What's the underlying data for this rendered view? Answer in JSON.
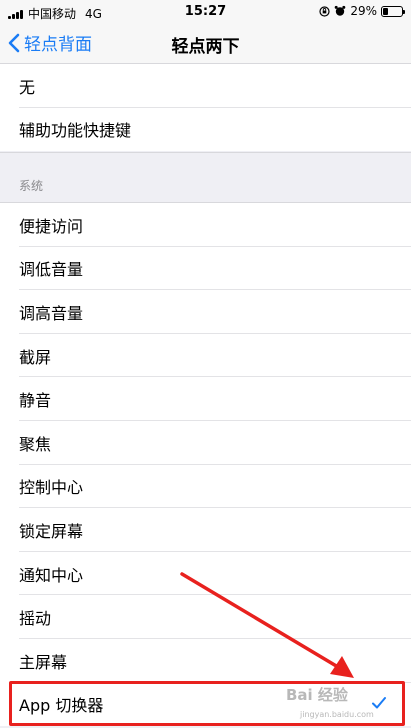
{
  "status_bar": {
    "carrier": "中国移动",
    "network": "4G",
    "time": "15:27",
    "battery": "29%",
    "battery_level": 0.29
  },
  "nav": {
    "back_label": "轻点背面",
    "title": "轻点两下"
  },
  "top_items": [
    {
      "label": "无"
    },
    {
      "label": "辅助功能快捷键"
    }
  ],
  "section": {
    "header": "系统"
  },
  "system_items": [
    {
      "label": "便捷访问"
    },
    {
      "label": "调低音量"
    },
    {
      "label": "调高音量"
    },
    {
      "label": "截屏"
    },
    {
      "label": "静音"
    },
    {
      "label": "聚焦"
    },
    {
      "label": "控制中心"
    },
    {
      "label": "锁定屏幕"
    },
    {
      "label": "通知中心"
    },
    {
      "label": "摇动"
    },
    {
      "label": "主屏幕"
    },
    {
      "label": "App 切换器",
      "selected": true
    }
  ],
  "watermark": {
    "brand": "Bai 经验",
    "url": "jingyan.baidu.com"
  },
  "colors": {
    "accent": "#1a7cf5",
    "annotation": "#e8211e"
  }
}
